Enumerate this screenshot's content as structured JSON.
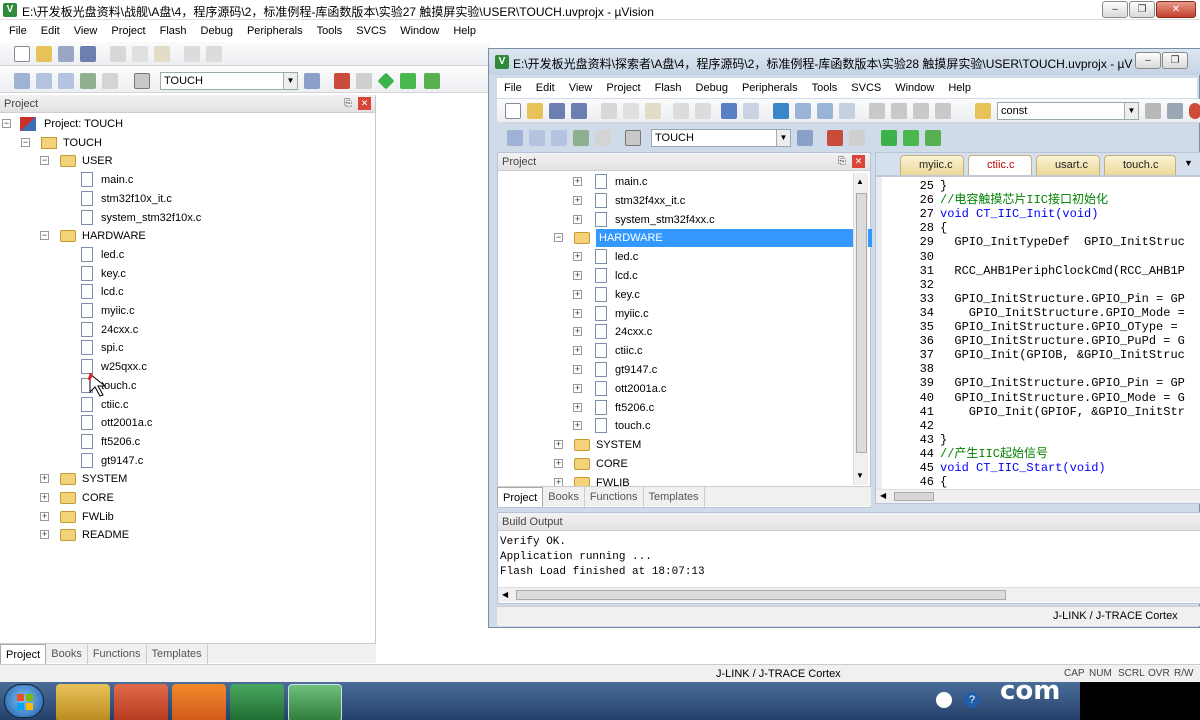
{
  "main_window": {
    "title": "E:\\开发板光盘资料\\战舰\\A盘\\4，程序源码\\2，标准例程-库函数版本\\实验27 触摸屏实验\\USER\\TOUCH.uvprojx - µVision",
    "menu": [
      "File",
      "Edit",
      "View",
      "Project",
      "Flash",
      "Debug",
      "Peripherals",
      "Tools",
      "SVCS",
      "Window",
      "Help"
    ],
    "target": "TOUCH",
    "project_panel_title": "Project",
    "tree": [
      {
        "label": "Project: TOUCH",
        "level": 0,
        "type": "root"
      },
      {
        "label": "TOUCH",
        "level": 1,
        "type": "target"
      },
      {
        "label": "USER",
        "level": 2,
        "type": "folder",
        "open": true
      },
      {
        "label": "main.c",
        "level": 3,
        "type": "file"
      },
      {
        "label": "stm32f10x_it.c",
        "level": 3,
        "type": "file"
      },
      {
        "label": "system_stm32f10x.c",
        "level": 3,
        "type": "file"
      },
      {
        "label": "HARDWARE",
        "level": 2,
        "type": "folder",
        "open": true
      },
      {
        "label": "led.c",
        "level": 3,
        "type": "file"
      },
      {
        "label": "key.c",
        "level": 3,
        "type": "file"
      },
      {
        "label": "lcd.c",
        "level": 3,
        "type": "file"
      },
      {
        "label": "myiic.c",
        "level": 3,
        "type": "file"
      },
      {
        "label": "24cxx.c",
        "level": 3,
        "type": "file"
      },
      {
        "label": "spi.c",
        "level": 3,
        "type": "file"
      },
      {
        "label": "w25qxx.c",
        "level": 3,
        "type": "file"
      },
      {
        "label": "touch.c",
        "level": 3,
        "type": "file"
      },
      {
        "label": "ctiic.c",
        "level": 3,
        "type": "file"
      },
      {
        "label": "ott2001a.c",
        "level": 3,
        "type": "file"
      },
      {
        "label": "ft5206.c",
        "level": 3,
        "type": "file"
      },
      {
        "label": "gt9147.c",
        "level": 3,
        "type": "file"
      },
      {
        "label": "SYSTEM",
        "level": 2,
        "type": "folder",
        "open": false
      },
      {
        "label": "CORE",
        "level": 2,
        "type": "folder",
        "open": false
      },
      {
        "label": "FWLib",
        "level": 2,
        "type": "folder",
        "open": false
      },
      {
        "label": "README",
        "level": 2,
        "type": "folder",
        "open": false
      }
    ],
    "bottom_tabs": [
      "Project",
      "Books",
      "Functions",
      "Templates"
    ],
    "status": "J-LINK / J-TRACE Cortex",
    "status_flags": [
      "CAP",
      "NUM",
      "SCRL",
      "OVR",
      "R/W"
    ]
  },
  "second_window": {
    "title": "E:\\开发板光盘资料\\探索者\\A盘\\4，程序源码\\2，标准例程-库函数版本\\实验28 触摸屏实验\\USER\\TOUCH.uvprojx - µVisi",
    "menu": [
      "File",
      "Edit",
      "View",
      "Project",
      "Flash",
      "Debug",
      "Peripherals",
      "Tools",
      "SVCS",
      "Window",
      "Help"
    ],
    "find_value": "const",
    "target": "TOUCH",
    "project_panel_title": "Project",
    "tree": [
      {
        "label": "main.c",
        "level": 3,
        "type": "file"
      },
      {
        "label": "stm32f4xx_it.c",
        "level": 3,
        "type": "file"
      },
      {
        "label": "system_stm32f4xx.c",
        "level": 3,
        "type": "file"
      },
      {
        "label": "HARDWARE",
        "level": 2,
        "type": "folder",
        "open": true,
        "selected": true
      },
      {
        "label": "led.c",
        "level": 3,
        "type": "file"
      },
      {
        "label": "lcd.c",
        "level": 3,
        "type": "file"
      },
      {
        "label": "key.c",
        "level": 3,
        "type": "file"
      },
      {
        "label": "myiic.c",
        "level": 3,
        "type": "file"
      },
      {
        "label": "24cxx.c",
        "level": 3,
        "type": "file"
      },
      {
        "label": "ctiic.c",
        "level": 3,
        "type": "file"
      },
      {
        "label": "gt9147.c",
        "level": 3,
        "type": "file"
      },
      {
        "label": "ott2001a.c",
        "level": 3,
        "type": "file"
      },
      {
        "label": "ft5206.c",
        "level": 3,
        "type": "file"
      },
      {
        "label": "touch.c",
        "level": 3,
        "type": "file"
      },
      {
        "label": "SYSTEM",
        "level": 2,
        "type": "folder",
        "open": false
      },
      {
        "label": "CORE",
        "level": 2,
        "type": "folder",
        "open": false
      },
      {
        "label": "FWLIB",
        "level": 2,
        "type": "folder",
        "open": false
      }
    ],
    "bottom_tabs": [
      "Project",
      "Books",
      "Functions",
      "Templates"
    ],
    "editor_tabs": [
      "myiic.c",
      "ctiic.c",
      "usart.c",
      "touch.c"
    ],
    "active_editor_tab": "ctiic.c",
    "code": [
      {
        "n": "25",
        "text": "}"
      },
      {
        "n": "26",
        "text": "//电容触摸芯片IIC接口初始化"
      },
      {
        "n": "27",
        "text": "void CT_IIC_Init(void)"
      },
      {
        "n": "28",
        "text": "{"
      },
      {
        "n": "29",
        "text": "  GPIO_InitTypeDef  GPIO_InitStruc"
      },
      {
        "n": "30",
        "text": ""
      },
      {
        "n": "31",
        "text": "  RCC_AHB1PeriphClockCmd(RCC_AHB1P"
      },
      {
        "n": "32",
        "text": ""
      },
      {
        "n": "33",
        "text": "  GPIO_InitStructure.GPIO_Pin = GP"
      },
      {
        "n": "34",
        "text": "    GPIO_InitStructure.GPIO_Mode ="
      },
      {
        "n": "35",
        "text": "  GPIO_InitStructure.GPIO_OType ="
      },
      {
        "n": "36",
        "text": "  GPIO_InitStructure.GPIO_PuPd = G"
      },
      {
        "n": "37",
        "text": "  GPIO_Init(GPIOB, &GPIO_InitStruc"
      },
      {
        "n": "38",
        "text": ""
      },
      {
        "n": "39",
        "text": "  GPIO_InitStructure.GPIO_Pin = GP"
      },
      {
        "n": "40",
        "text": "  GPIO_InitStructure.GPIO_Mode = G"
      },
      {
        "n": "41",
        "text": "    GPIO_Init(GPIOF, &GPIO_InitStr"
      },
      {
        "n": "42",
        "text": ""
      },
      {
        "n": "43",
        "text": "}"
      },
      {
        "n": "44",
        "text": "//产生IIC起始信号"
      },
      {
        "n": "45",
        "text": "void CT_IIC_Start(void)"
      },
      {
        "n": "46",
        "text": "{"
      }
    ],
    "build_output_title": "Build Output",
    "build_output": [
      "Verify OK.",
      "Application running ...",
      "Flash Load finished at 18:07:13"
    ],
    "status": "J-LINK / J-TRACE Cortex"
  },
  "taskbar": {
    "tray_text": "com"
  },
  "colors": {
    "keyword": "#0000ff",
    "comment": "#008000",
    "selection": "#3399ff"
  }
}
